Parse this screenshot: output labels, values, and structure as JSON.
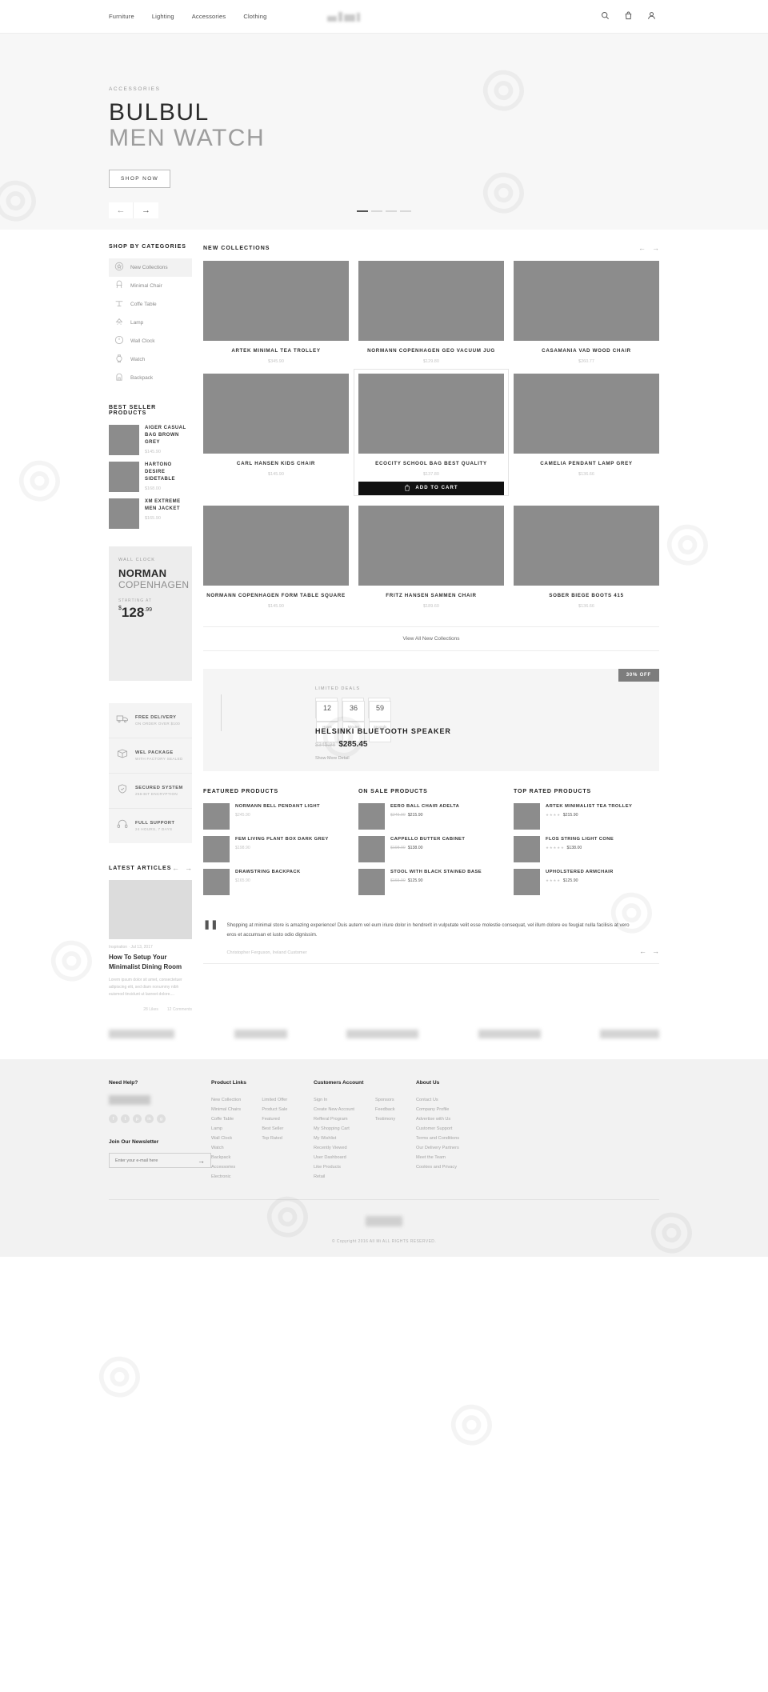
{
  "nav": {
    "items": [
      "Furniture",
      "Lighting",
      "Accessories",
      "Clothing"
    ],
    "icons": [
      "search-icon",
      "bag-icon",
      "user-icon"
    ]
  },
  "hero": {
    "eyebrow": "ACCESSORIES",
    "title_bold": "BULBUL",
    "title_light": "MEN WATCH",
    "cta": "SHOP NOW",
    "prev": "←",
    "next": "→"
  },
  "sidebar": {
    "categories_title": "SHOP BY CATEGORIES",
    "categories": [
      {
        "label": "New Collections",
        "icon": "star-badge-icon",
        "active": true
      },
      {
        "label": "Minimal Chair",
        "icon": "chair-icon",
        "active": false
      },
      {
        "label": "Coffe Table",
        "icon": "table-icon",
        "active": false
      },
      {
        "label": "Lamp",
        "icon": "lamp-icon",
        "active": false
      },
      {
        "label": "Wall Clock",
        "icon": "clock-icon",
        "active": false
      },
      {
        "label": "Watch",
        "icon": "watch-icon",
        "active": false
      },
      {
        "label": "Backpack",
        "icon": "backpack-icon",
        "active": false
      }
    ],
    "bestseller_title": "BEST SELLER PRODUCTS",
    "bestsellers": [
      {
        "name": "AIGER CASUAL BAG BROWN GREY",
        "price": "$145.90"
      },
      {
        "name": "HARTONO DESIRE SIDETABLE",
        "price": "$168.00"
      },
      {
        "name": "XM EXTREME MEN JACKET",
        "price": "$165.90"
      }
    ],
    "promo": {
      "kicker": "WALL CLOCK",
      "line1": "NORMAN",
      "line2": "COPENHAGEN",
      "starting": "STARTING AT",
      "currency": "$",
      "amount": "128",
      "cents": ".99"
    },
    "features": [
      {
        "title": "FREE DELIVERY",
        "sub": "ON ORDER OVER $100",
        "icon": "truck-icon"
      },
      {
        "title": "WEL PACKAGE",
        "sub": "WITH FACTORY SEALED",
        "icon": "package-icon"
      },
      {
        "title": "SECURED SYSTEM",
        "sub": "256-BIT ENCRYPTION",
        "icon": "shield-icon"
      },
      {
        "title": "FULL SUPPORT",
        "sub": "24 HOURS, 7 DAYS",
        "icon": "headset-icon"
      }
    ],
    "articles_title": "LATEST ARTICLES",
    "article": {
      "meta": "Inspiration · Jul 13, 2017",
      "title": "How To Setup Your Minimalist Dining Room",
      "excerpt": "Lorem ipsum dolor sit amet, consectetuer adipiscing elit, sed diam nonummy nibh euismod tincidunt ut laoreet dolore....",
      "likes": "28 Likes",
      "comments": "12 Comments"
    }
  },
  "collections": {
    "title": "NEW COLLECTIONS",
    "prev": "←",
    "next": "→",
    "view_all": "View All New Collections",
    "items": [
      {
        "name": "ARTEK MINIMAL TEA TROLLEY",
        "price": "$345.90",
        "hover": false
      },
      {
        "name": "NORMANN COPENHAGEN GEO VACUUM JUG",
        "price": "$129.80",
        "hover": false
      },
      {
        "name": "CASAMANIA VAD WOOD CHAIR",
        "price": "$260.77",
        "hover": false
      },
      {
        "name": "CARL HANSEN KIDS CHAIR",
        "price": "$145.90",
        "hover": false
      },
      {
        "name": "ECOCITY SCHOOL BAG BEST QUALITY",
        "price": "$137.80",
        "hover": true,
        "add_to_cart": "ADD TO CART"
      },
      {
        "name": "CAMELIA PENDANT LAMP GREY",
        "price": "$136.66",
        "hover": false
      },
      {
        "name": "NORMANN COPENHAGEN FORM TABLE SQUARE",
        "price": "$145.90",
        "hover": false
      },
      {
        "name": "FRITZ HANSEN SAMMEN CHAIR",
        "price": "$189.60",
        "hover": false
      },
      {
        "name": "SOBER BIEGE BOOTS 415",
        "price": "$136.66",
        "hover": false
      }
    ]
  },
  "deals": {
    "badge": "30% OFF",
    "label": "LIMITED DEALS",
    "countdown": [
      {
        "value": "12",
        "unit": "Hours"
      },
      {
        "value": "36",
        "unit": "Minutes"
      },
      {
        "value": "59",
        "unit": "Seconds"
      }
    ],
    "product": "HELSINKI BLUETOOTH SPEAKER",
    "old_price": "$345.98",
    "price": "$285.45",
    "more": "Show More Detail"
  },
  "columns": [
    {
      "title": "FEATURED PRODUCTS",
      "items": [
        {
          "name": "NORMANN BELL PENDANT LIGHT",
          "price": "$245.90"
        },
        {
          "name": "FEM LIVING PLANT BOX DARK GREY",
          "price": "$198.90"
        },
        {
          "name": "DRAWSTRING BACKPACK",
          "price": "$165.90"
        }
      ]
    },
    {
      "title": "ON SALE PRODUCTS",
      "items": [
        {
          "name": "EERO BALL CHAIR ADELTA",
          "old_price": "$245.90",
          "price": "$215.90"
        },
        {
          "name": "CAPPELLO BUTTER CABINET",
          "old_price": "$198.00",
          "price": "$138.00"
        },
        {
          "name": "STOOL WITH BLACK STAINED BASE",
          "old_price": "$165.90",
          "price": "$125.90"
        }
      ]
    },
    {
      "title": "TOP RATED PRODUCTS",
      "items": [
        {
          "name": "ARTEK MINIMALIST TEA TROLLEY",
          "stars": "★★★★",
          "price": "$215.90"
        },
        {
          "name": "FLOS STRING LIGHT CONE",
          "stars": "★★★★★",
          "price": "$138.00"
        },
        {
          "name": "UPHOLSTERED ARMCHAIR",
          "stars": "★★★★",
          "price": "$125.90"
        }
      ]
    }
  ],
  "testimonial": {
    "quote_mark": "❚❚",
    "text": "Shopping at minimal store is amazing experience! Duis autem vel eum iriure dolor in hendrerit in vulputate velit esse molestie consequat, vel illum dolore eu feugiat nulla facilisis at vero eros et accumsan et iusto odio dignissim.",
    "author": "Christopher Ferguson,",
    "author_meta": "Ireland Customer",
    "prev": "←",
    "next": "→"
  },
  "footer": {
    "need_help_title": "Need Help?",
    "social": [
      "f",
      "t",
      "p",
      "in",
      "g"
    ],
    "newsletter_title": "Join Our Newsletter",
    "newsletter_placeholder": "Enter your e-mail here",
    "newsletter_go": "→",
    "groups": [
      {
        "title": "Product Links",
        "col_a": [
          "New Collection",
          "Minimal Chairs",
          "Coffe Table",
          "Lamp",
          "Wall Clock",
          "Watch",
          "Backpack",
          "Accessories",
          "Electronic"
        ],
        "col_b": [
          "Limited Offer",
          "Product Sale",
          "Featured",
          "Best Seller",
          "Top Rated"
        ]
      },
      {
        "title": "Customers Account",
        "col_a": [
          "Sign In",
          "Create New Account",
          "Refferal Program",
          "My Shopping Cart",
          "My Wishlist",
          "Recently Viewed",
          "User Dashboard",
          "Like Products",
          "Retail"
        ],
        "col_b": [
          "Sponsors",
          "Feedback",
          "Testimony"
        ]
      },
      {
        "title": "About Us",
        "col_a": [
          "Contact Us",
          "Company Profile",
          "Advertise with Us",
          "Customer Support",
          "Terms and Conditions",
          "Our Delivery Partners",
          "Meet the Team",
          "Cookies and Privacy"
        ],
        "col_b": []
      }
    ],
    "copyright": "© Copyright 2016 All Mi ALL RIGHTS RESERVED."
  }
}
